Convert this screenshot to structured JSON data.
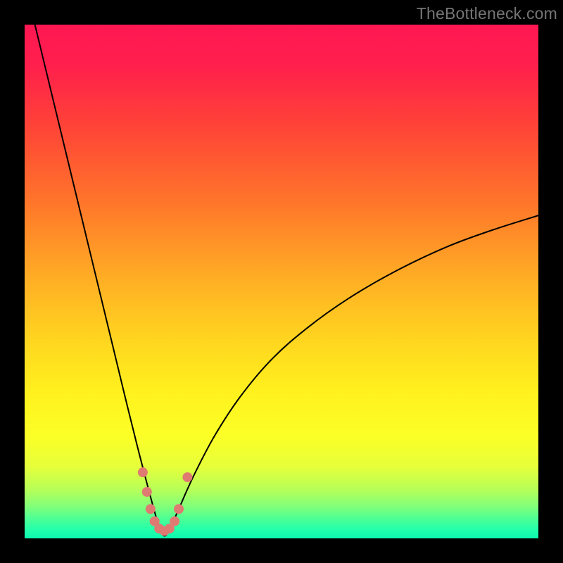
{
  "watermark": "TheBottleneck.com",
  "colors": {
    "frame": "#000000",
    "watermark": "#767676",
    "curve_stroke": "#000000",
    "marker_fill": "#df7a72",
    "gradient_stops": [
      {
        "offset": 0.0,
        "color": "#ff1753"
      },
      {
        "offset": 0.08,
        "color": "#ff1f4c"
      },
      {
        "offset": 0.2,
        "color": "#ff4437"
      },
      {
        "offset": 0.35,
        "color": "#ff772a"
      },
      {
        "offset": 0.5,
        "color": "#ffb024"
      },
      {
        "offset": 0.62,
        "color": "#ffd71f"
      },
      {
        "offset": 0.72,
        "color": "#fff21e"
      },
      {
        "offset": 0.8,
        "color": "#fcff26"
      },
      {
        "offset": 0.86,
        "color": "#e6ff3a"
      },
      {
        "offset": 0.905,
        "color": "#b7ff58"
      },
      {
        "offset": 0.94,
        "color": "#7dff7c"
      },
      {
        "offset": 0.965,
        "color": "#46ff99"
      },
      {
        "offset": 0.985,
        "color": "#1fffac"
      },
      {
        "offset": 1.0,
        "color": "#0cf7af"
      }
    ]
  },
  "chart_data": {
    "type": "line",
    "title": "",
    "xlabel": "",
    "ylabel": "",
    "xlim": [
      0,
      100
    ],
    "ylim": [
      0,
      105
    ],
    "x_optimum": 27.2,
    "note": "V-shaped bottleneck curve. Left branch drops steeply from ~(2,105) to trough; right branch rises with decreasing slope to ~(100,66). Minimum ≈0 at x≈27.2.",
    "series": [
      {
        "name": "bottleneck-curve",
        "x": [
          2,
          5,
          8,
          11,
          14,
          17,
          20,
          22.5,
          24.5,
          26,
          27.2,
          28.5,
          30,
          33,
          37,
          42,
          48,
          55,
          63,
          72,
          82,
          91,
          100
        ],
        "y": [
          105,
          92,
          79,
          66,
          53,
          40,
          27,
          16.5,
          8.5,
          3,
          0.5,
          2.5,
          6,
          13,
          21,
          29,
          36.5,
          43,
          49,
          54.5,
          59.5,
          63,
          66
        ]
      }
    ],
    "markers": {
      "name": "optimum-cluster",
      "note": "Salmon dots clustered at trough of curve",
      "points": [
        {
          "x": 23.0,
          "y": 13.5
        },
        {
          "x": 23.8,
          "y": 9.5
        },
        {
          "x": 24.5,
          "y": 6.0
        },
        {
          "x": 25.3,
          "y": 3.5
        },
        {
          "x": 26.2,
          "y": 2.0
        },
        {
          "x": 27.2,
          "y": 1.5
        },
        {
          "x": 28.2,
          "y": 2.0
        },
        {
          "x": 29.2,
          "y": 3.5
        },
        {
          "x": 30.0,
          "y": 6.0
        },
        {
          "x": 31.7,
          "y": 12.5
        }
      ]
    }
  }
}
